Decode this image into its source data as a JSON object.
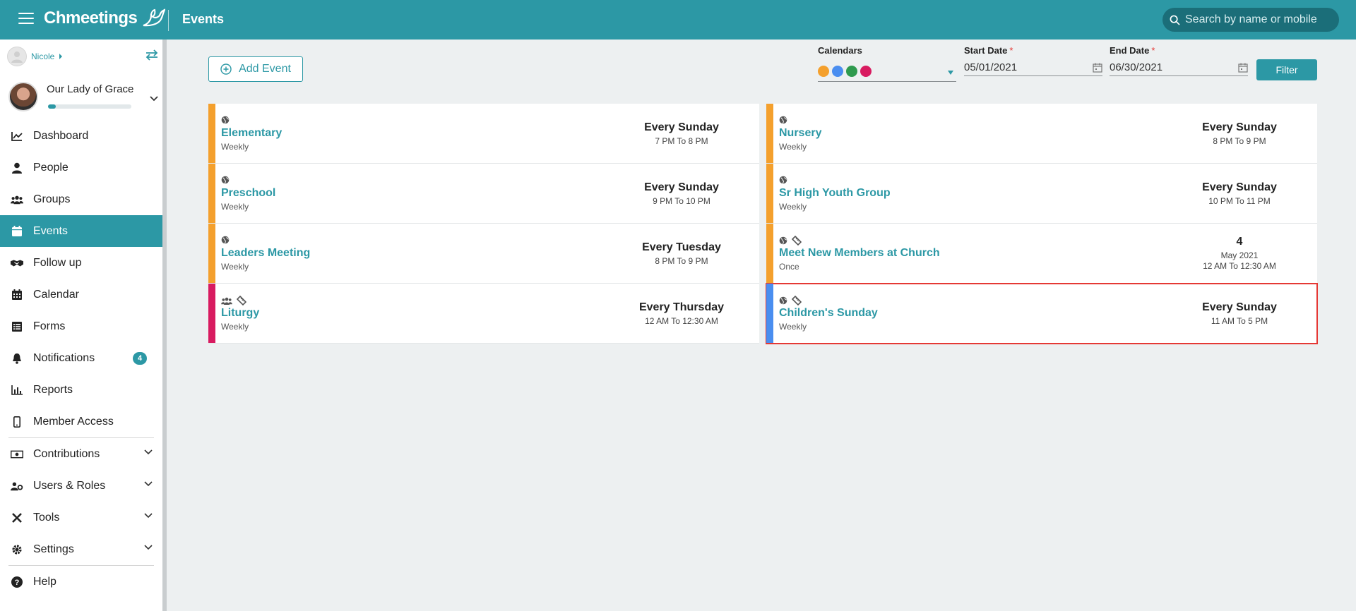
{
  "header": {
    "logo_text": "Chmeetings",
    "page_title": "Events",
    "search_placeholder": "Search by name or mobile"
  },
  "sidebar": {
    "user_name": "Nicole",
    "org_name": "Our Lady of Grace",
    "org_progress": 0.09,
    "items": [
      {
        "label": "Dashboard",
        "icon": "chart-line-icon"
      },
      {
        "label": "People",
        "icon": "user-icon"
      },
      {
        "label": "Groups",
        "icon": "users-icon"
      },
      {
        "label": "Events",
        "icon": "calendar-icon",
        "active": true
      },
      {
        "label": "Follow up",
        "icon": "handshake-icon"
      },
      {
        "label": "Calendar",
        "icon": "calendar-grid-icon"
      },
      {
        "label": "Forms",
        "icon": "list-icon"
      },
      {
        "label": "Notifications",
        "icon": "bell-icon",
        "badge": "4"
      },
      {
        "label": "Reports",
        "icon": "bar-chart-icon"
      },
      {
        "label": "Member Access",
        "icon": "mobile-icon"
      },
      {
        "label": "Contributions",
        "icon": "money-icon"
      },
      {
        "label": "Users & Roles",
        "icon": "users-cog-icon"
      },
      {
        "label": "Tools",
        "icon": "tools-icon"
      },
      {
        "label": "Settings",
        "icon": "gear-icon"
      },
      {
        "label": "Help",
        "icon": "help-icon"
      }
    ]
  },
  "toolbar": {
    "add_event_label": "Add Event",
    "calendars_label": "Calendars",
    "calendar_colors": [
      "#f4a02d",
      "#4a8ef0",
      "#2e9a4e",
      "#d81b60"
    ],
    "start_date_label": "Start Date",
    "start_date_value": "05/01/2021",
    "end_date_label": "End Date",
    "end_date_value": "06/30/2021",
    "required_mark": "*",
    "filter_label": "Filter"
  },
  "events_left": [
    {
      "name": "Elementary",
      "freq": "Weekly",
      "day": "Every Sunday",
      "time": "7 PM To 8 PM",
      "color": "#f4a02d",
      "icons": [
        "globe-icon"
      ]
    },
    {
      "name": "Preschool",
      "freq": "Weekly",
      "day": "Every Sunday",
      "time": "9 PM To 10 PM",
      "color": "#f4a02d",
      "icons": [
        "globe-icon"
      ]
    },
    {
      "name": "Leaders Meeting",
      "freq": "Weekly",
      "day": "Every Tuesday",
      "time": "8 PM To 9 PM",
      "color": "#f4a02d",
      "icons": [
        "globe-icon"
      ]
    },
    {
      "name": "Liturgy",
      "freq": "Weekly",
      "day": "Every Thursday",
      "time": "12 AM To 12:30 AM",
      "color": "#d81b60",
      "icons": [
        "users-icon",
        "ticket-icon"
      ]
    }
  ],
  "events_right": [
    {
      "name": "Nursery",
      "freq": "Weekly",
      "day": "Every Sunday",
      "time": "8 PM To 9 PM",
      "color": "#f4a02d",
      "icons": [
        "globe-icon"
      ]
    },
    {
      "name": "Sr High Youth Group",
      "freq": "Weekly",
      "day": "Every Sunday",
      "time": "10 PM To 11 PM",
      "color": "#f4a02d",
      "icons": [
        "globe-icon"
      ]
    },
    {
      "name": "Meet New Members at Church",
      "freq": "Once",
      "date_num": "4",
      "date_month": "May 2021",
      "time": "12 AM To 12:30 AM",
      "color": "#f4a02d",
      "icons": [
        "globe-icon",
        "ticket-icon"
      ]
    },
    {
      "name": "Children's Sunday",
      "freq": "Weekly",
      "day": "Every Sunday",
      "time": "11 AM To 5 PM",
      "color": "#4a8ef0",
      "icons": [
        "globe-icon",
        "ticket-icon"
      ],
      "selected": true
    }
  ]
}
